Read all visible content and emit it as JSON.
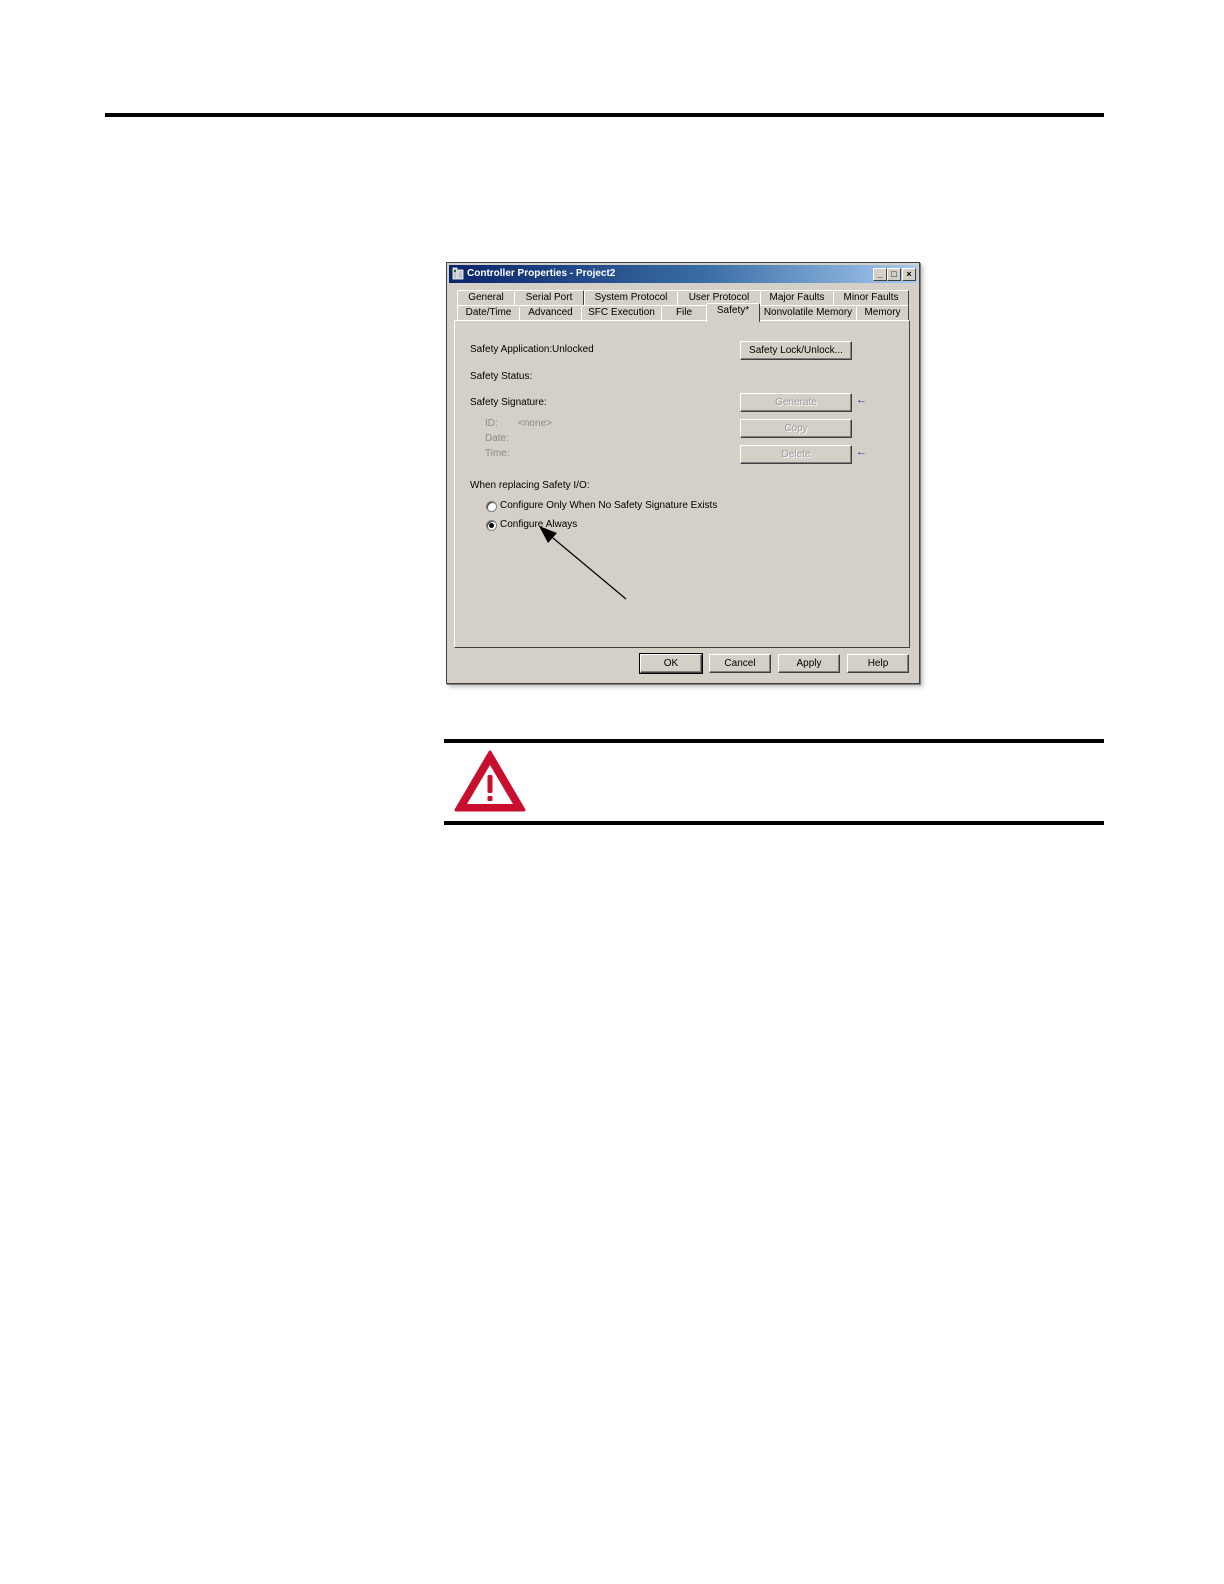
{
  "dialog": {
    "title": "Controller Properties - Project2",
    "window_buttons": {
      "minimize": "_",
      "maximize": "□",
      "close": "×"
    },
    "tabs_row1": [
      "General",
      "Serial Port",
      "System Protocol",
      "User Protocol",
      "Major Faults",
      "Minor Faults"
    ],
    "tabs_row2": [
      "Date/Time",
      "Advanced",
      "SFC Execution",
      "File",
      "Safety*",
      "Nonvolatile Memory",
      "Memory"
    ],
    "active_tab": "Safety*",
    "safety": {
      "application_label": "Safety Application:",
      "application_value": "Unlocked",
      "status_label": "Safety Status:",
      "signature_label": "Safety Signature:",
      "id_label": "ID:",
      "id_value": "<none>",
      "date_label": "Date:",
      "time_label": "Time:",
      "lock_button": "Safety Lock/Unlock...",
      "generate_button": "Generate",
      "copy_button": "Copy",
      "delete_button": "Delete",
      "replacing_label": "When replacing Safety I/O:",
      "radio_option_1": "Configure Only When No Safety Signature Exists",
      "radio_option_2": "Configure Always",
      "selected_option": "Configure Always"
    },
    "footer_buttons": {
      "ok": "OK",
      "cancel": "Cancel",
      "apply": "Apply",
      "help": "Help"
    }
  },
  "colors": {
    "dialog_face": "#d4d0c8",
    "title_gradient_start": "#0a246a",
    "title_gradient_end": "#a6caf0",
    "warning_red": "#c8102e",
    "pointer_arrow": "#1a2fb0"
  },
  "icons": {
    "title_icon": "controller-icon",
    "warning_icon": "warning-triangle-icon",
    "annotation_arrow": "callout-arrow"
  }
}
